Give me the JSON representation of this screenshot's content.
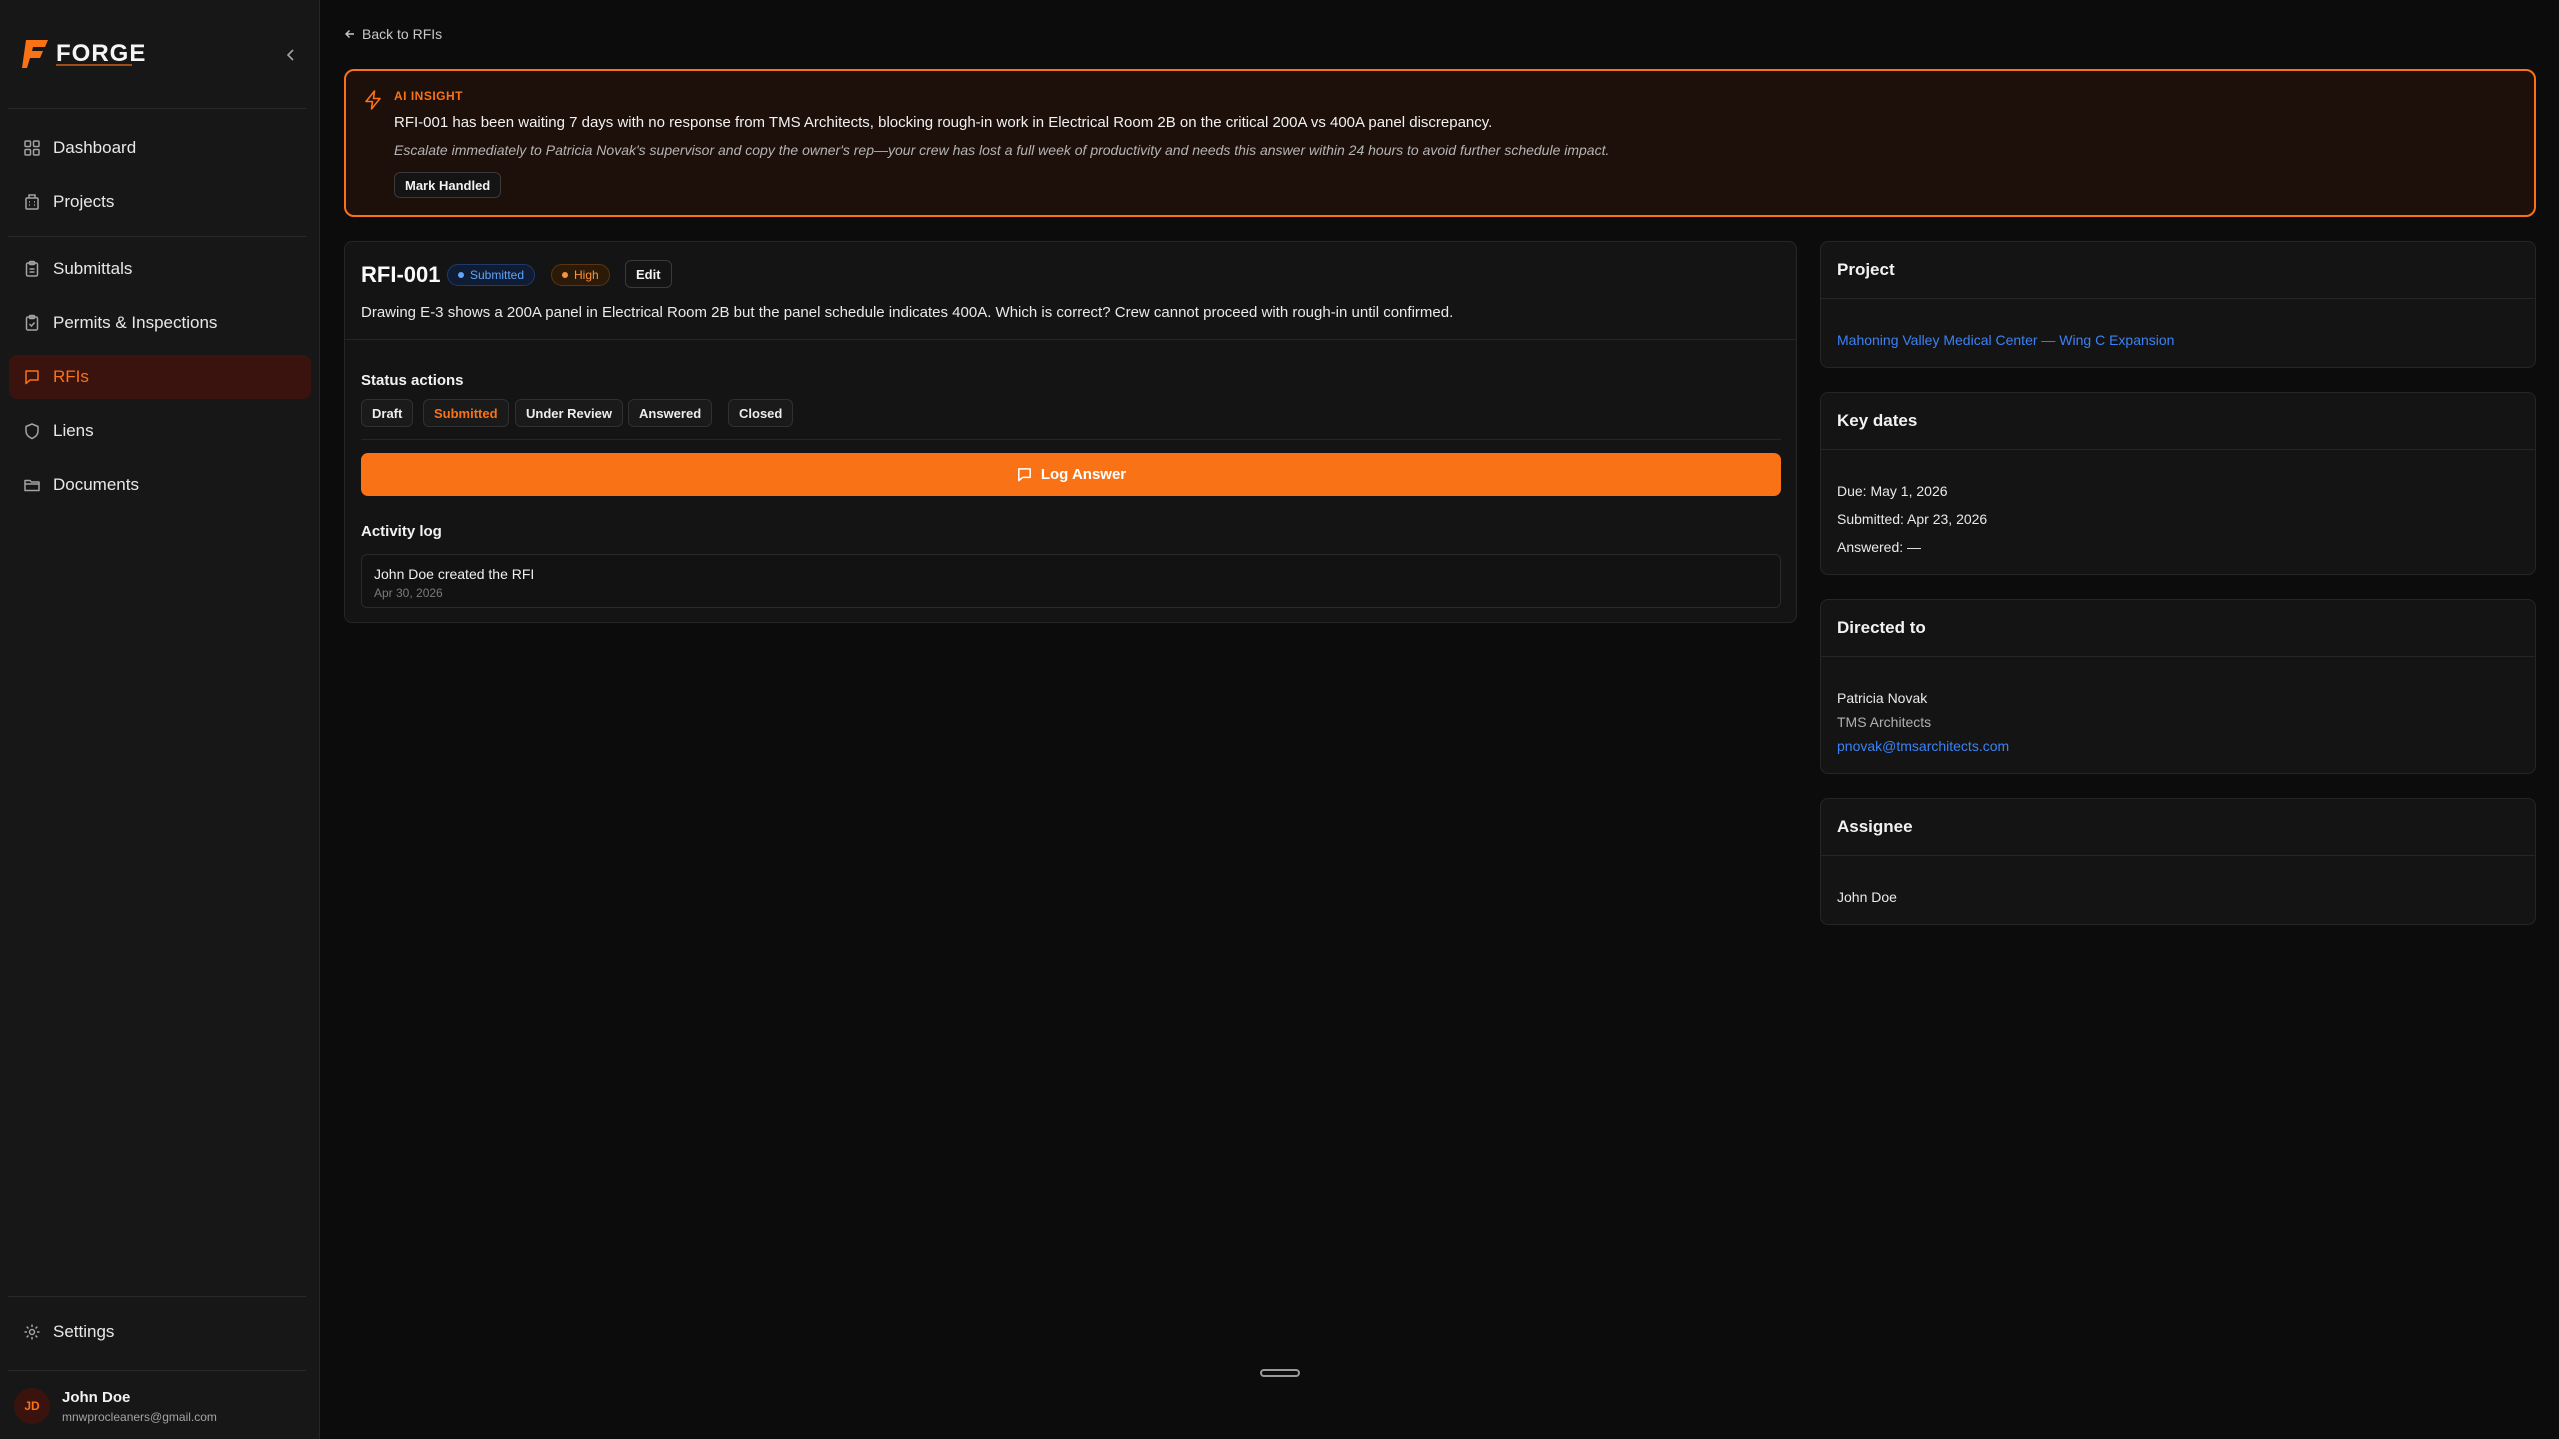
{
  "brand": {
    "name": "FORGE"
  },
  "sidebar": {
    "items": [
      {
        "label": "Dashboard",
        "icon": "grid-icon"
      },
      {
        "label": "Projects",
        "icon": "building-icon"
      },
      {
        "label": "Submittals",
        "icon": "clipboard-icon"
      },
      {
        "label": "Permits & Inspections",
        "icon": "clipboard-check-icon"
      },
      {
        "label": "RFIs",
        "icon": "message-square-icon",
        "active": true
      },
      {
        "label": "Liens",
        "icon": "shield-icon"
      },
      {
        "label": "Documents",
        "icon": "folder-icon"
      }
    ],
    "settings_label": "Settings",
    "user": {
      "initials": "JD",
      "name": "John Doe",
      "email": "mnwprocleaners@gmail.com"
    }
  },
  "back_link": "Back to RFIs",
  "insight": {
    "label": "AI INSIGHT",
    "message": "RFI-001 has been waiting 7 days with no response from TMS Architects, blocking rough-in work in Electrical Room 2B on the critical 200A vs 400A panel discrepancy.",
    "recommendation": "Escalate immediately to Patricia Novak's supervisor and copy the owner's rep—your crew has lost a full week of productivity and needs this answer within 24 hours to avoid further schedule impact.",
    "button": "Mark Handled"
  },
  "rfi": {
    "number": "RFI-001",
    "status_badge": "Submitted",
    "priority_badge": "High",
    "edit_label": "Edit",
    "question": "Drawing E-3 shows a 200A panel in Electrical Room 2B but the panel schedule indicates 400A. Which is correct? Crew cannot proceed with rough-in until confirmed.",
    "status_actions_label": "Status actions",
    "statuses": [
      "Draft",
      "Submitted",
      "Under Review",
      "Answered",
      "Closed"
    ],
    "current_status": "Submitted",
    "log_answer_label": "Log Answer",
    "activity_label": "Activity log",
    "activity": [
      {
        "text": "John Doe created the RFI",
        "date": "Apr 30, 2026"
      }
    ]
  },
  "project_card": {
    "title": "Project",
    "link": "Mahoning Valley Medical Center — Wing C Expansion"
  },
  "dates_card": {
    "title": "Key dates",
    "due": "Due: May 1, 2026",
    "submitted": "Submitted: Apr 23, 2026",
    "answered": "Answered: —"
  },
  "directed_card": {
    "title": "Directed to",
    "name": "Patricia Novak",
    "company": "TMS Architects",
    "email": "pnovak@tmsarchitects.com"
  },
  "assignee_card": {
    "title": "Assignee",
    "name": "John Doe"
  },
  "colors": {
    "accent": "#f97316",
    "link": "#3b82f6",
    "background": "#0c0c0c",
    "panel": "#141414"
  }
}
